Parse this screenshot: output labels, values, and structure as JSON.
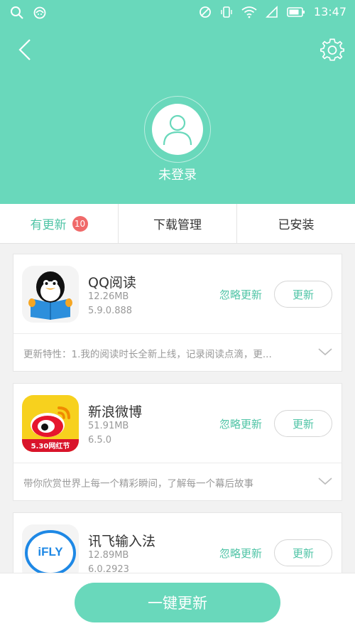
{
  "status_bar": {
    "time": "13:47"
  },
  "profile": {
    "login_status": "未登录"
  },
  "tabs": [
    {
      "label": "有更新",
      "badge": "10"
    },
    {
      "label": "下载管理"
    },
    {
      "label": "已安装"
    }
  ],
  "apps": [
    {
      "name": "QQ阅读",
      "size": "12.26MB",
      "version": "5.9.0.888",
      "ignore_label": "忽略更新",
      "update_label": "更新",
      "description": "更新特性：1.我的阅读时长全新上线，记录阅读点滴，更..."
    },
    {
      "name": "新浪微博",
      "size": "51.91MB",
      "version": "6.5.0",
      "ignore_label": "忽略更新",
      "update_label": "更新",
      "description": "带你欣赏世界上每一个精彩瞬间，了解每一个幕后故事",
      "icon_badge": "5.30网红节"
    },
    {
      "name": "讯飞输入法",
      "size": "12.89MB",
      "version": "6.0.2923",
      "ignore_label": "忽略更新",
      "update_label": "更新",
      "icon_text": "iFLY"
    }
  ],
  "bottom": {
    "one_key_update": "一键更新"
  },
  "colors": {
    "accent": "#69d8bb",
    "accent_text": "#4fc4a6",
    "badge": "#f06a6a"
  }
}
